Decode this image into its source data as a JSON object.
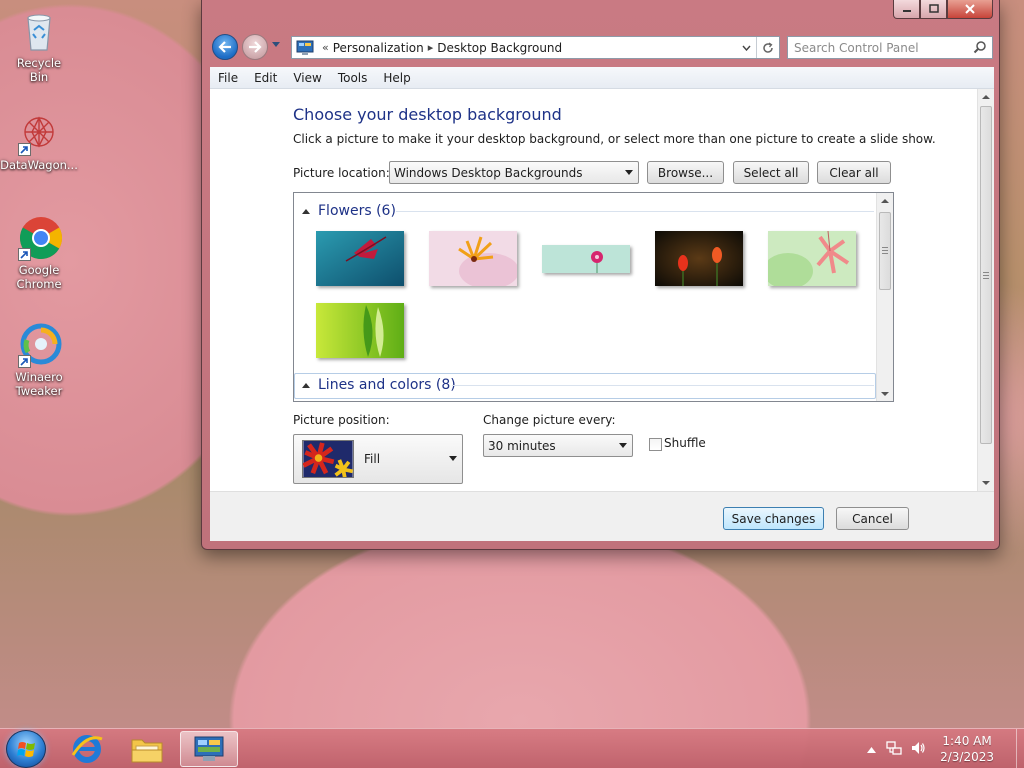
{
  "desktop": {
    "icons": [
      {
        "label": "Recycle Bin"
      },
      {
        "label": "DataWagon..."
      },
      {
        "label": "Google Chrome"
      },
      {
        "label": "Winaero Tweaker"
      }
    ]
  },
  "window": {
    "address": {
      "crumbs": [
        "Personalization",
        "Desktop Background"
      ],
      "overflow": "«",
      "separator": "▸"
    },
    "search_placeholder": "Search Control Panel",
    "menu": [
      "File",
      "Edit",
      "View",
      "Tools",
      "Help"
    ],
    "heading": "Choose your desktop background",
    "subtext": "Click a picture to make it your desktop background, or select more than one picture to create a slide show.",
    "picture_location_label": "Picture location:",
    "picture_location_value": "Windows Desktop Backgrounds",
    "buttons": {
      "browse": "Browse...",
      "select_all": "Select all",
      "clear_all": "Clear all"
    },
    "groups": [
      {
        "title": "Flowers (6)"
      },
      {
        "title": "Lines and colors (8)"
      }
    ],
    "picture_position_label": "Picture position:",
    "picture_position_value": "Fill",
    "change_every_label": "Change picture every:",
    "change_every_value": "30 minutes",
    "shuffle_label": "Shuffle",
    "save_label": "Save changes",
    "cancel_label": "Cancel"
  },
  "taskbar": {
    "time": "1:40 AM",
    "date": "2/3/2023"
  },
  "colors": {
    "heading_blue": "#1e3287",
    "window_frame": "#c97a83",
    "taskbar": "#d27884"
  }
}
